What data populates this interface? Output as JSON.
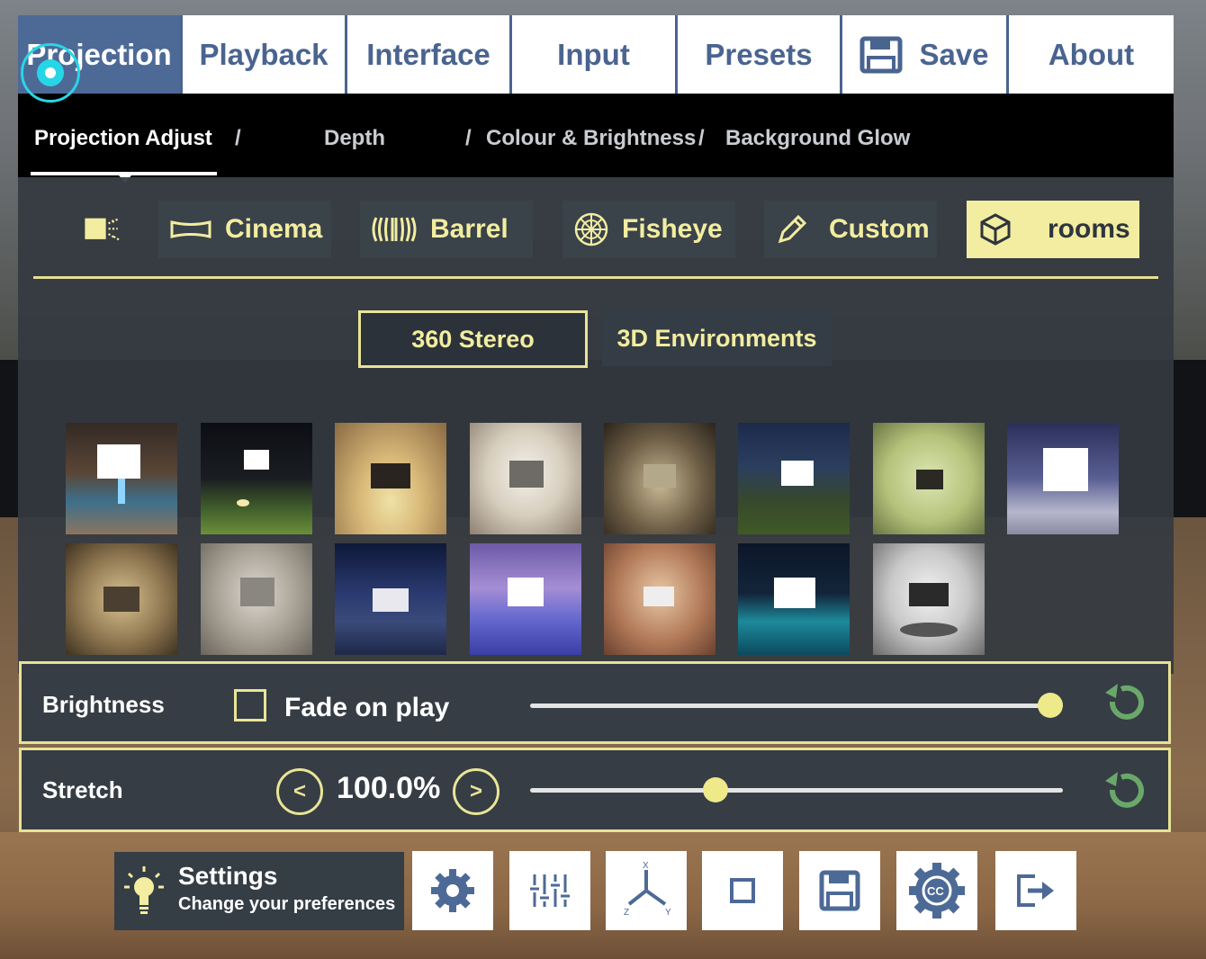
{
  "tabs": [
    {
      "label": "Projection",
      "active": true
    },
    {
      "label": "Playback"
    },
    {
      "label": "Interface"
    },
    {
      "label": "Input"
    },
    {
      "label": "Presets"
    },
    {
      "label": "Save",
      "icon": "floppy-disk-icon"
    },
    {
      "label": "About"
    }
  ],
  "subnav": {
    "items": [
      "Projection Adjust",
      "Depth",
      "Colour & Brightness",
      "Background Glow"
    ],
    "separator": "/"
  },
  "modes": [
    {
      "label": "",
      "icon": "projector-icon"
    },
    {
      "label": "Cinema",
      "icon": "wide-screen-icon"
    },
    {
      "label": "Barrel",
      "icon": "barrel-icon"
    },
    {
      "label": "Fisheye",
      "icon": "fisheye-icon"
    },
    {
      "label": "Custom",
      "icon": "pencil-icon"
    },
    {
      "label": "rooms",
      "icon": "cube-icon",
      "active": true
    }
  ],
  "environment_tabs": [
    {
      "label": "360 Stereo",
      "active": true
    },
    {
      "label": "3D Environments"
    }
  ],
  "thumbnails": [
    "outdoor-cinema-thumbnail",
    "night-garden-thumbnail",
    "home-theater-thumbnail",
    "white-lounge-thumbnail",
    "dark-lounge-thumbnail",
    "backyard-screen-thumbnail",
    "green-room-thumbnail",
    "city-night-thumbnail",
    "beige-theater-thumbnail",
    "grey-room-thumbnail",
    "starry-dome-thumbnail",
    "tropical-pool-thumbnail",
    "red-theater-thumbnail",
    "night-pool-thumbnail",
    "modern-lounge-thumbnail"
  ],
  "brightness": {
    "label": "Brightness",
    "fade_label": "Fade on play",
    "fade_checked": false,
    "level": 1.0
  },
  "stretch": {
    "label": "Stretch",
    "value": "100.0%",
    "level": 0.34,
    "dec": "<",
    "inc": ">"
  },
  "settings": {
    "title": "Settings",
    "subtitle": "Change your preferences"
  },
  "toolbar": [
    "gear-icon",
    "equalizer-icon",
    "axes-icon",
    "square-icon",
    "floppy-disk-icon",
    "subtitles-gear-icon",
    "exit-icon"
  ],
  "colors": {
    "accent": "#f2eda0",
    "tab_text": "#4a6490",
    "tab_active": "#4d6a97",
    "cursor": "#27d6e6",
    "reset": "#6aa86a"
  }
}
